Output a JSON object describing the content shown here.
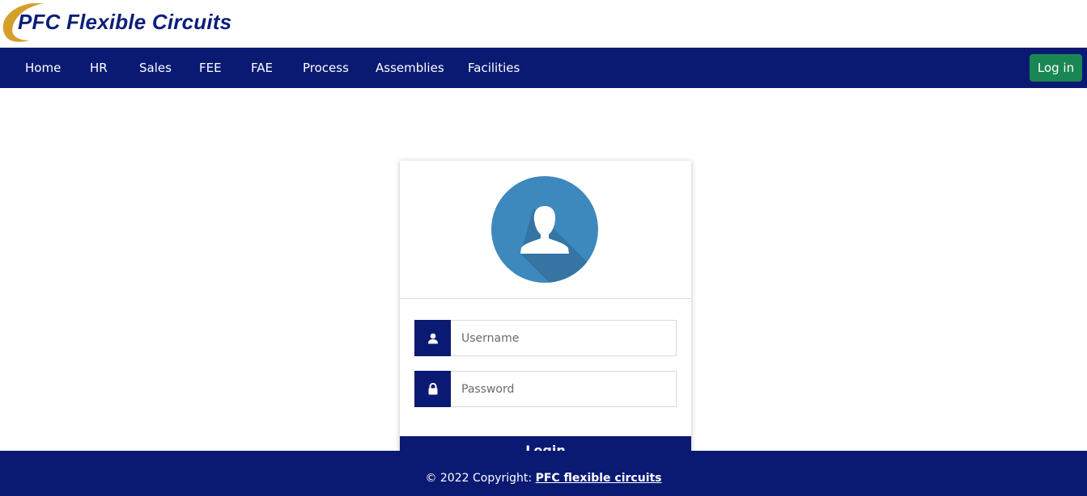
{
  "brand": {
    "logo_text": "PFC Flexible Circuits",
    "colors": {
      "primary": "#0a1a73",
      "accent": "#d4a02a",
      "success": "#198754"
    }
  },
  "nav": {
    "items": [
      {
        "label": "Home"
      },
      {
        "label": "HR"
      },
      {
        "label": "Sales"
      },
      {
        "label": "FEE"
      },
      {
        "label": "FAE"
      },
      {
        "label": "Process"
      },
      {
        "label": "Assemblies"
      },
      {
        "label": "Facilities"
      }
    ],
    "login_label": "Log in"
  },
  "login_form": {
    "avatar_icon": "user-avatar-icon",
    "username": {
      "placeholder": "Username",
      "value": "",
      "icon": "user-icon"
    },
    "password": {
      "placeholder": "Password",
      "value": "",
      "icon": "lock-icon"
    },
    "submit_label": "Login"
  },
  "footer": {
    "copyright_prefix": "© 2022 Copyright: ",
    "link_text": "PFC flexible circuits"
  }
}
